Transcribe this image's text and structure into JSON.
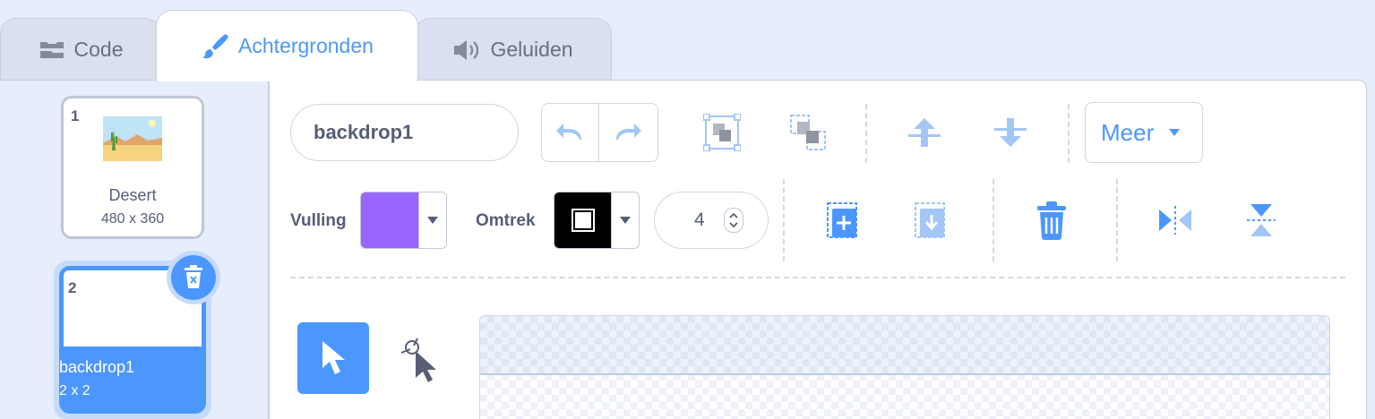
{
  "tabs": [
    {
      "label": "Code",
      "icon": "code-blocks-icon"
    },
    {
      "label": "Achtergronden",
      "icon": "paintbrush-icon"
    },
    {
      "label": "Geluiden",
      "icon": "speaker-icon"
    }
  ],
  "backdrops": [
    {
      "number": "1",
      "name": "Desert",
      "size": "480 x 360"
    },
    {
      "number": "2",
      "name": "backdrop1",
      "size": "2 x 2"
    }
  ],
  "editor": {
    "name_value": "backdrop1",
    "more_label": "Meer",
    "fill_label": "Vulling",
    "fill_color": "#9966ff",
    "outline_label": "Omtrek",
    "outline_color": "#000000",
    "stroke_width": "4"
  },
  "colors": {
    "accent": "#4c97ff",
    "delete_button": "#4c97ff"
  }
}
